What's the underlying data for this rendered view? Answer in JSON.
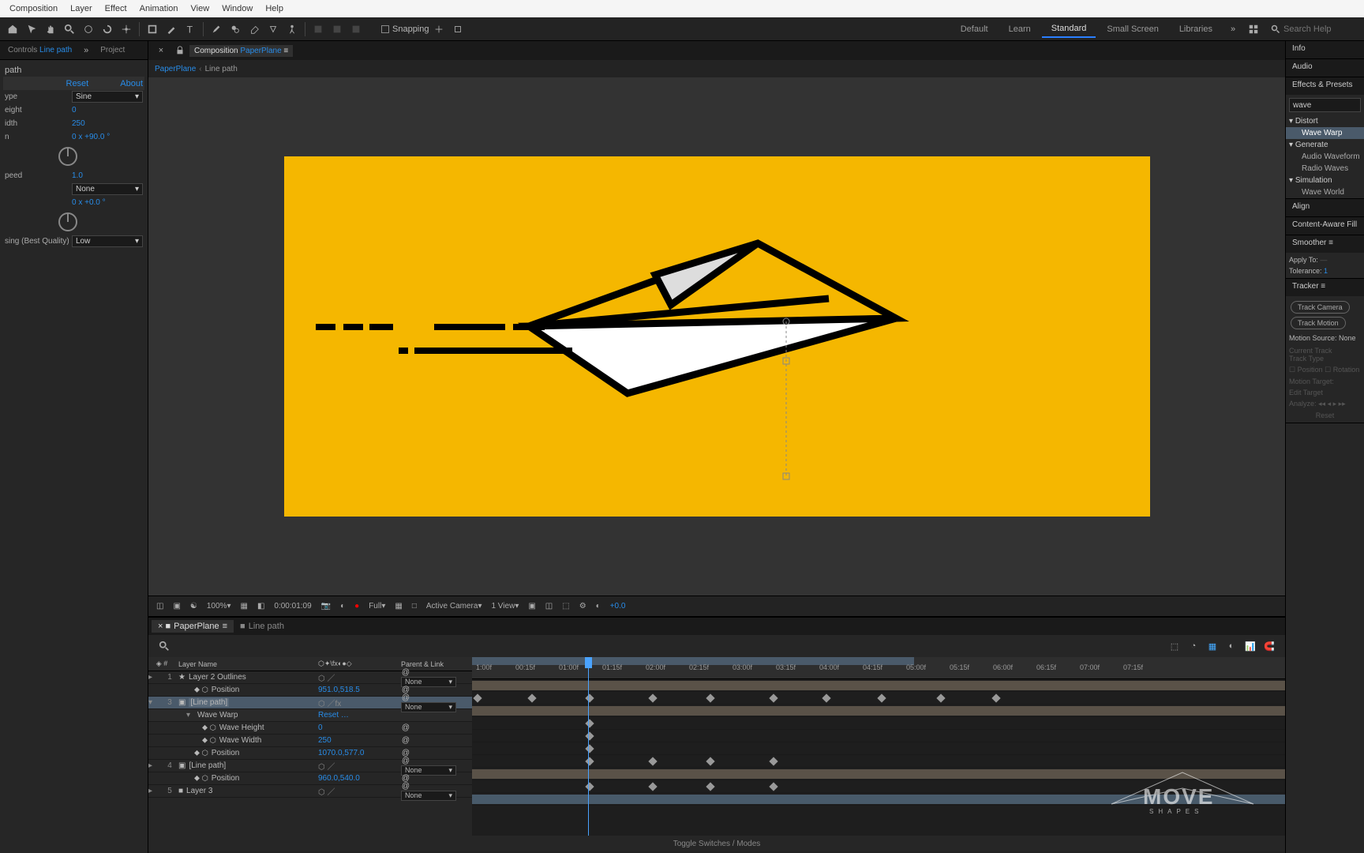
{
  "menu": {
    "items": [
      "Composition",
      "Layer",
      "Effect",
      "Animation",
      "View",
      "Window",
      "Help"
    ]
  },
  "toolbar": {
    "snapping": "Snapping"
  },
  "workspaces": {
    "items": [
      "Default",
      "Learn",
      "Standard",
      "Small Screen",
      "Libraries"
    ],
    "active": "Standard"
  },
  "search_help": {
    "placeholder": "Search Help"
  },
  "left_panel": {
    "tab_controls": "Controls",
    "tab_active": "Line path",
    "tab_project": "Project",
    "effect_source": "path",
    "reset": "Reset",
    "about": "About",
    "rows": {
      "type_label": "ype",
      "type_value": "Sine",
      "height_label": "eight",
      "height_value": "0",
      "width_label": "idth",
      "width_value": "250",
      "n_label": "n",
      "n_value": "0 x +90.0 °",
      "speed_label": "peed",
      "speed_value": "1.0",
      "pinning_value": "None",
      "phase_value": "0 x +0.0 °",
      "antialias_label": "sing (Best Quality)",
      "antialias_value": "Low"
    }
  },
  "comp": {
    "tab_label": "Composition",
    "comp_name": "PaperPlane",
    "breadcrumb_main": "PaperPlane",
    "breadcrumb_sub": "Line path"
  },
  "viewer_footer": {
    "zoom": "100%",
    "timecode": "0:00:01:09",
    "res": "Full",
    "camera": "Active Camera",
    "views": "1 View",
    "exposure": "+0.0"
  },
  "timeline": {
    "tab1": "PaperPlane",
    "tab2": "Line path",
    "ruler": [
      "1:00f",
      "00:15f",
      "01:00f",
      "01:15f",
      "02:00f",
      "02:15f",
      "03:00f",
      "03:15f",
      "04:00f",
      "04:15f",
      "05:00f",
      "05:15f",
      "06:00f",
      "06:15f",
      "07:00f",
      "07:15f"
    ],
    "header": {
      "name": "Layer Name",
      "parent": "Parent & Link"
    },
    "layers": [
      {
        "num": "1",
        "name": "Layer 2 Outlines",
        "parent": "None"
      },
      {
        "prop": "Position",
        "value": "951.0,518.5"
      },
      {
        "num": "3",
        "name": "[Line path]",
        "parent": "None",
        "selected": true
      },
      {
        "effect": "Wave Warp",
        "value": "Reset"
      },
      {
        "prop": "Wave Height",
        "value": "0"
      },
      {
        "prop": "Wave Width",
        "value": "250"
      },
      {
        "prop": "Position",
        "value": "1070.0,577.0"
      },
      {
        "num": "4",
        "name": "[Line path]",
        "parent": "None"
      },
      {
        "prop": "Position",
        "value": "960.0,540.0"
      },
      {
        "num": "5",
        "name": "Layer 3",
        "parent": "None"
      }
    ],
    "footer": "Toggle Switches / Modes"
  },
  "right": {
    "info": "Info",
    "audio": "Audio",
    "effects_presets": "Effects & Presets",
    "search_value": "wave",
    "fx": {
      "cat1": "Distort",
      "item1": "Wave Warp",
      "cat2": "Generate",
      "item2a": "Audio Waveform",
      "item2b": "Radio Waves",
      "cat3": "Simulation",
      "item3": "Wave World"
    },
    "align": "Align",
    "content_aware": "Content-Aware Fill",
    "smoother": "Smoother",
    "apply_to": "Apply To:",
    "tolerance": "Tolerance:",
    "tolerance_val": "1",
    "tracker": "Tracker",
    "track_camera": "Track Camera",
    "track_motion": "Track Motion",
    "motion_source": "Motion Source:",
    "motion_source_val": "None",
    "current_track": "Current Track",
    "track_type": "Track Type",
    "position_cb": "Position",
    "rotation_cb": "Rotation",
    "motion_target": "Motion Target:",
    "edit_target": "Edit Target",
    "analyze": "Analyze:",
    "reset_btn": "Reset"
  }
}
